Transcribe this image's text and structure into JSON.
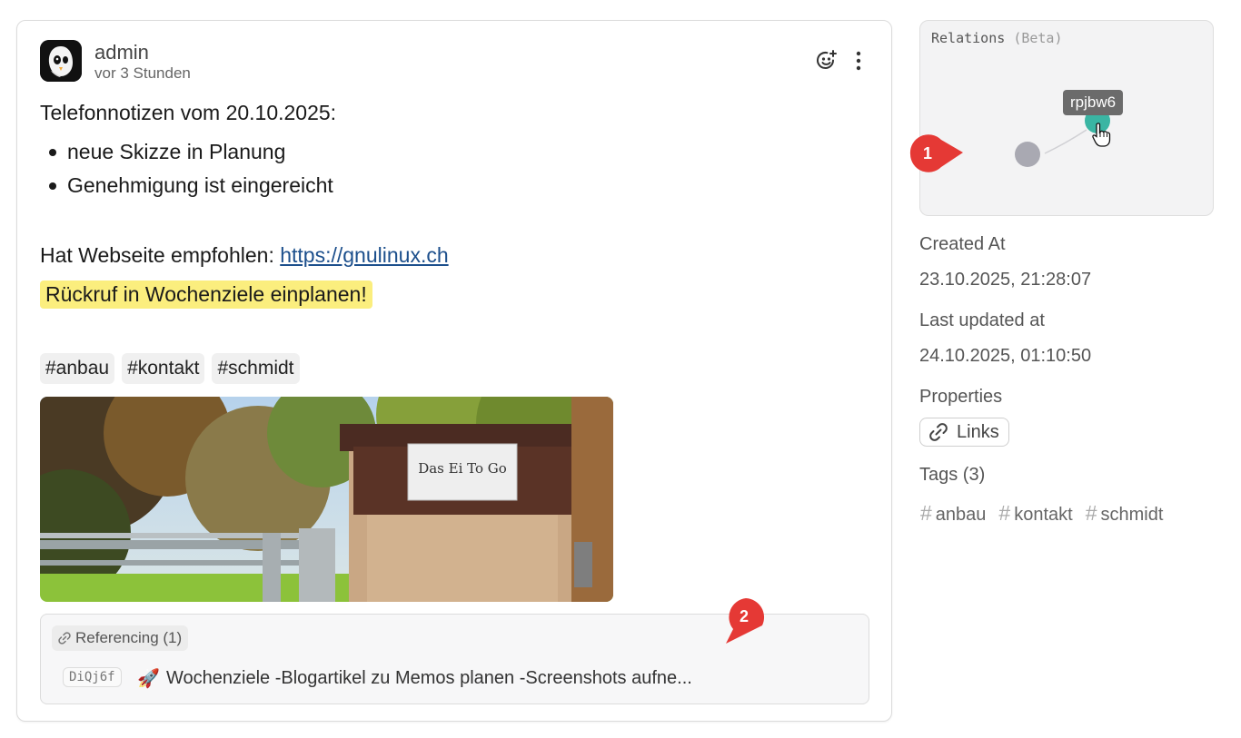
{
  "memo": {
    "author": "admin",
    "time_ago": "vor 3 Stunden",
    "title": "Telefonnotizen vom 20.10.2025:",
    "bullets": [
      "neue Skizze in Planung",
      "Genehmigung ist eingereicht"
    ],
    "recommend_text": "Hat Webseite empfohlen: ",
    "recommend_link": "https://gnulinux.ch",
    "highlight": "Rückruf in Wochenziele einplanen!",
    "tags": [
      "#anbau",
      "#kontakt",
      "#schmidt"
    ],
    "photo_sign": "Das Ei To Go",
    "referencing_label": "Referencing (1)",
    "reference": {
      "id": "DiQj6f",
      "emoji": "🚀",
      "text": "Wochenziele -Blogartikel zu Memos planen -Screenshots aufne..."
    }
  },
  "sidebar": {
    "relations_title": "Relations",
    "relations_beta": "(Beta)",
    "node_tooltip": "rpjbw6",
    "created_label": "Created At",
    "created_value": "23.10.2025, 21:28:07",
    "updated_label": "Last updated at",
    "updated_value": "24.10.2025, 01:10:50",
    "properties_label": "Properties",
    "links_label": "Links",
    "tags_label": "Tags (3)",
    "tags": [
      "anbau",
      "kontakt",
      "schmidt"
    ]
  },
  "markers": [
    "1",
    "2"
  ],
  "colors": {
    "highlight": "#fbee7e",
    "link": "#1c4f8c",
    "node_active": "#3ab5a3",
    "node_inactive": "#a9a9b2",
    "marker": "#e53935"
  }
}
